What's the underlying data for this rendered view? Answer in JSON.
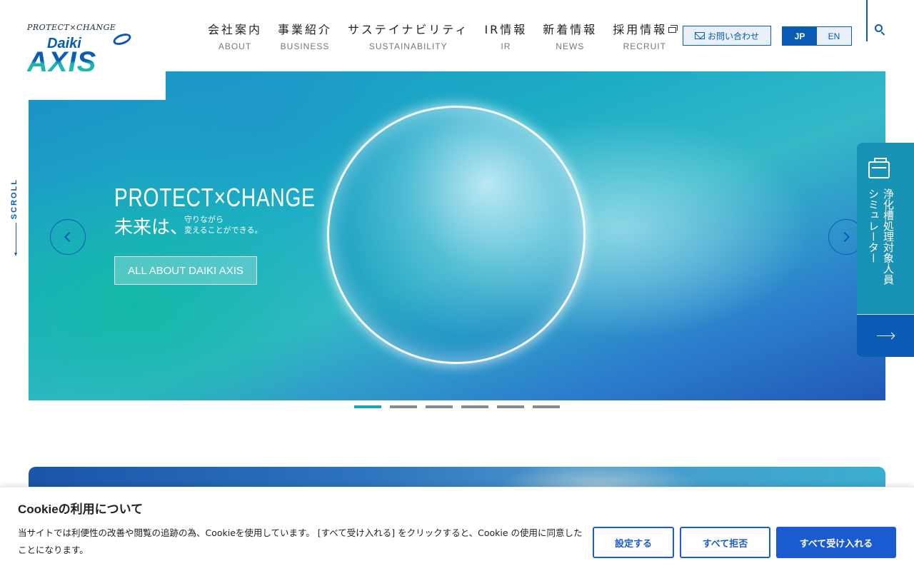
{
  "logo": {
    "tagline": "PROTECT×CHANGE",
    "brand_top": "Daiki",
    "brand_main": "AXIS"
  },
  "nav": [
    {
      "jp": "会社案内",
      "en": "ABOUT"
    },
    {
      "jp": "事業紹介",
      "en": "BUSINESS"
    },
    {
      "jp": "サステイナビリティ",
      "en": "SUSTAINABILITY"
    },
    {
      "jp": "IR情報",
      "en": "IR"
    },
    {
      "jp": "新着情報",
      "en": "NEWS"
    },
    {
      "jp": "採用情報",
      "en": "RECRUIT"
    }
  ],
  "header": {
    "contact_label": "お問い合わせ",
    "lang_jp": "JP",
    "lang_en": "EN"
  },
  "hero": {
    "title": "PROTECT×CHANGE",
    "main_text": "未来は、",
    "sub_line1": "守りながら",
    "sub_line2": "変えることができる。",
    "button_label": "ALL ABOUT DAIKI AXIS",
    "slide_count": 6,
    "active_slide": 1
  },
  "scroll": {
    "label": "SCROLL"
  },
  "simulator": {
    "col1": "浄化槽処理対象人員",
    "col2": "シミュレーター"
  },
  "cookie": {
    "title": "Cookieの利用について",
    "body": "当サイトでは利便性の改善や閲覧の追跡の為、Cookieを使用しています。 [すべて受け入れる] をクリックすると、Cookie の使用に同意したことになります。",
    "settings_label": "設定する",
    "reject_label": "すべて拒否",
    "accept_label": "すべて受け入れる"
  },
  "colors": {
    "brand_blue": "#0a5bb5",
    "teal": "#1993b5",
    "cookie_blue": "#1a5bd0",
    "active_dot": "#1aa6b7"
  }
}
